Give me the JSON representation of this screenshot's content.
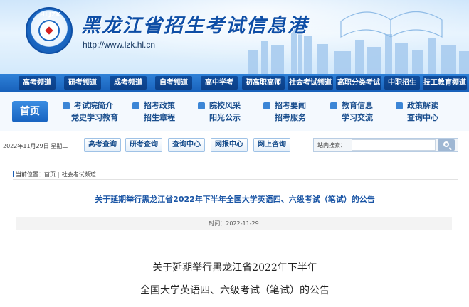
{
  "header": {
    "logo_tag": "HLJZK",
    "site_title": "黑龙江省招生考试信息港",
    "site_url": "http://www.lzk.hl.cn"
  },
  "nav": {
    "items": [
      "高考频道",
      "研考频道",
      "成考频道",
      "自考频道",
      "高中学考",
      "初高职高师",
      "社会考试频道",
      "高职分类考试",
      "中职招生",
      "技工教育频道"
    ]
  },
  "quicklinks": {
    "home": "首页",
    "columns": [
      [
        "考试院简介",
        "党史学习教育"
      ],
      [
        "招考政策",
        "招生章程"
      ],
      [
        "院校风采",
        "阳光公示"
      ],
      [
        "招考要闻",
        "招考服务"
      ],
      [
        "教育信息",
        "学习交流"
      ],
      [
        "政策解读",
        "查询中心"
      ]
    ]
  },
  "search_row": {
    "date": "2022年11月29日  星期二",
    "buttons": [
      "高考查询",
      "研考查询",
      "查询中心",
      "网报中心",
      "网上咨询"
    ],
    "search_label": "站内搜索：",
    "search_value": ""
  },
  "article": {
    "breadcrumb": [
      "当前位置：",
      "首页",
      "社会考试频道"
    ],
    "headline": "关于延期举行黑龙江省2022年下半年全国大学英语四、六级考试（笔试）的公告",
    "time": "时间：2022-11-29",
    "body_title_line1": "关于延期举行黑龙江省2022年下半年",
    "body_title_line2": "全国大学英语四、六级考试（笔试）的公告"
  },
  "colors": {
    "brand_blue": "#1861bb",
    "link_blue": "#1a55a5"
  }
}
